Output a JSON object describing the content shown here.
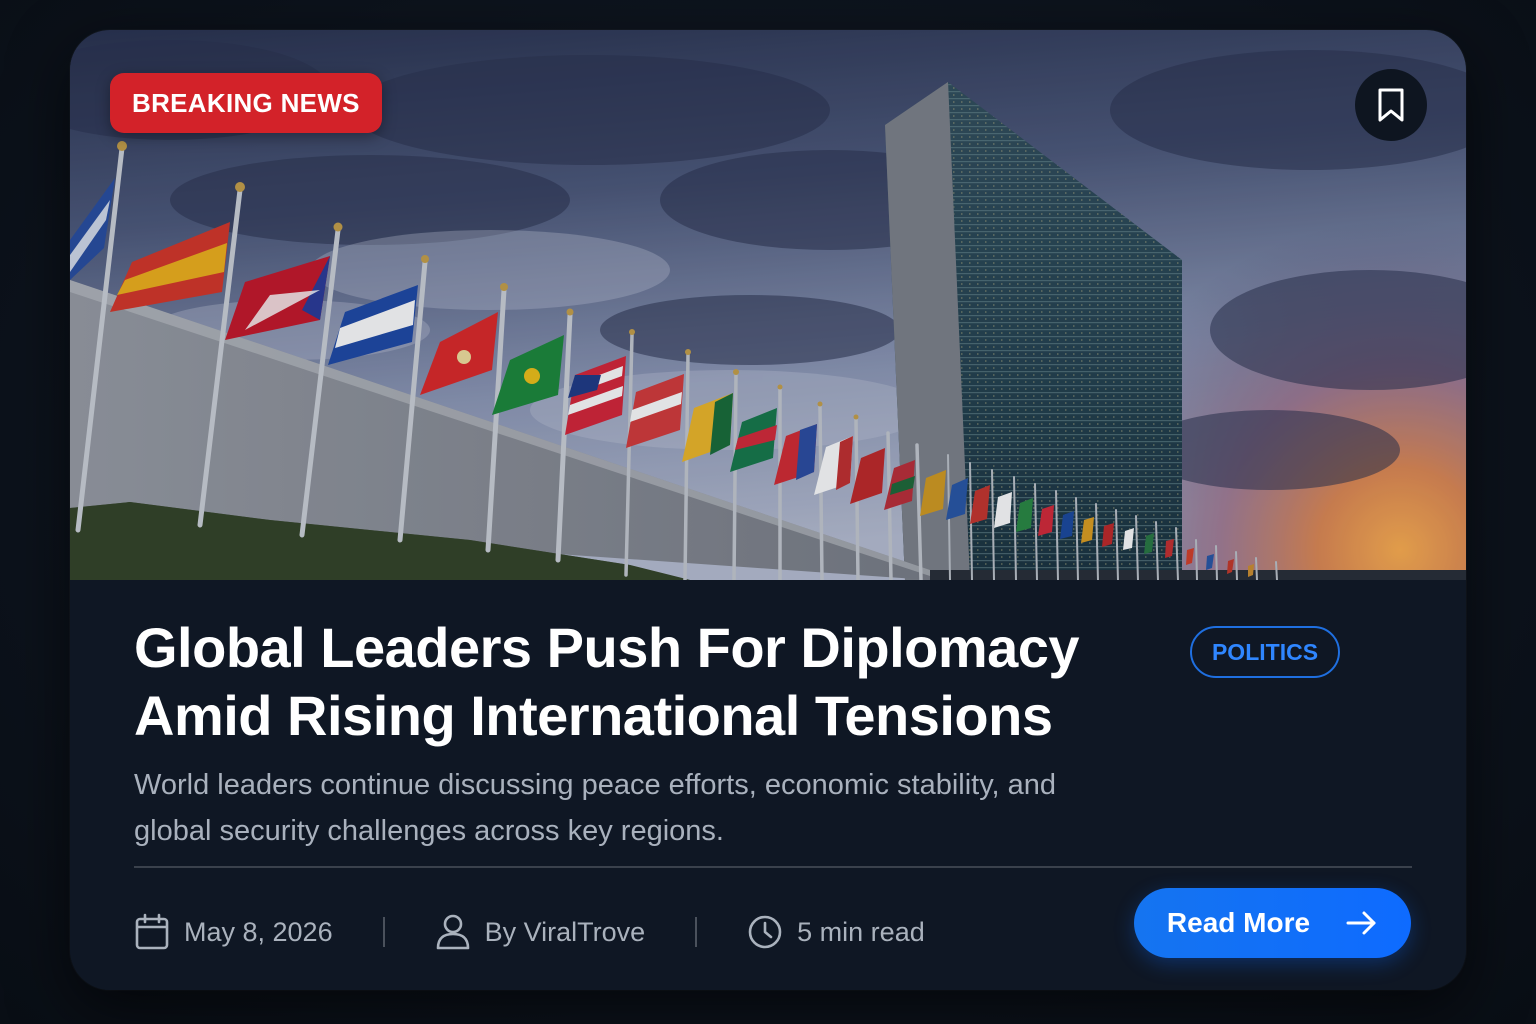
{
  "article": {
    "badge": "BREAKING NEWS",
    "title": "Global Leaders Push For Diplomacy Amid Rising International Tensions",
    "category": "POLITICS",
    "summary": "World leaders continue discussing peace efforts, economic stability, and global security challenges across key regions.",
    "date": "May 8, 2026",
    "author": "By ViralTrove",
    "read_time": "5 min read",
    "cta_label": "Read More"
  },
  "colors": {
    "background": "#0d131d",
    "card": "#0f1724",
    "breaking_badge": "#d32229",
    "accent_blue": "#0e6bff",
    "category_text": "#2f86ff"
  },
  "icons": {
    "bookmark": "bookmark-icon",
    "date": "calendar-icon",
    "author": "user-icon",
    "read_time": "clock-icon",
    "cta": "arrow-right-icon"
  }
}
